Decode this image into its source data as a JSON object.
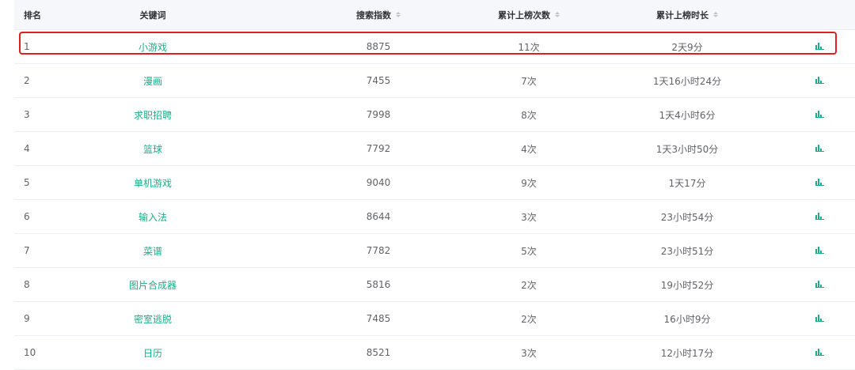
{
  "table": {
    "headers": {
      "rank": "排名",
      "keyword": "关键词",
      "search_index": "搜索指数",
      "times_on_list": "累计上榜次数",
      "duration_on_list": "累计上榜时长"
    },
    "rows": [
      {
        "rank": "1",
        "keyword": "小游戏",
        "search_index": "8875",
        "times_on_list": "11次",
        "duration_on_list": "2天9分"
      },
      {
        "rank": "2",
        "keyword": "漫画",
        "search_index": "7455",
        "times_on_list": "7次",
        "duration_on_list": "1天16小时24分"
      },
      {
        "rank": "3",
        "keyword": "求职招聘",
        "search_index": "7998",
        "times_on_list": "8次",
        "duration_on_list": "1天4小时6分"
      },
      {
        "rank": "4",
        "keyword": "篮球",
        "search_index": "7792",
        "times_on_list": "4次",
        "duration_on_list": "1天3小时50分"
      },
      {
        "rank": "5",
        "keyword": "单机游戏",
        "search_index": "9040",
        "times_on_list": "9次",
        "duration_on_list": "1天17分"
      },
      {
        "rank": "6",
        "keyword": "输入法",
        "search_index": "8644",
        "times_on_list": "3次",
        "duration_on_list": "23小时54分"
      },
      {
        "rank": "7",
        "keyword": "菜谱",
        "search_index": "7782",
        "times_on_list": "5次",
        "duration_on_list": "23小时51分"
      },
      {
        "rank": "8",
        "keyword": "图片合成器",
        "search_index": "5816",
        "times_on_list": "2次",
        "duration_on_list": "19小时52分"
      },
      {
        "rank": "9",
        "keyword": "密室逃脱",
        "search_index": "7485",
        "times_on_list": "2次",
        "duration_on_list": "16小时9分"
      },
      {
        "rank": "10",
        "keyword": "日历",
        "search_index": "8521",
        "times_on_list": "3次",
        "duration_on_list": "12小时17分"
      }
    ]
  },
  "icons": {
    "sort": "sort-caret-icon",
    "trend": "bar-chart-icon"
  },
  "colors": {
    "keyword_link": "#1aad8a",
    "chart_icon": "#1aad8a",
    "highlight_border": "#e02020",
    "header_bg": "#f5f7fa"
  }
}
